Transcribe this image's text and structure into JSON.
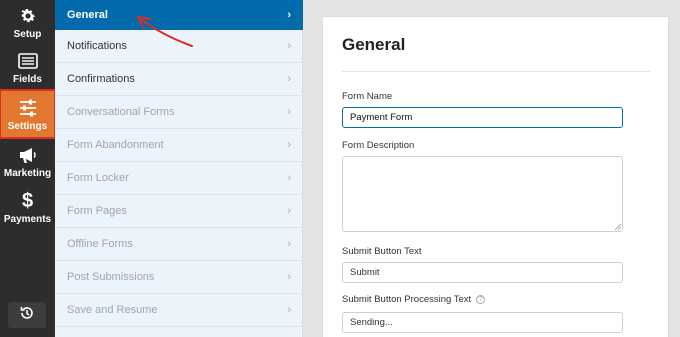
{
  "sidebar": {
    "items": [
      {
        "label": "Setup",
        "icon": "gear-icon"
      },
      {
        "label": "Fields",
        "icon": "list-icon"
      },
      {
        "label": "Settings",
        "icon": "sliders-icon"
      },
      {
        "label": "Marketing",
        "icon": "megaphone-icon"
      },
      {
        "label": "Payments",
        "icon": "dollar-icon"
      }
    ],
    "bottom_icon": "history-icon",
    "active_color": "#e27730"
  },
  "menu": {
    "items": [
      {
        "label": "General"
      },
      {
        "label": "Notifications"
      },
      {
        "label": "Confirmations"
      },
      {
        "label": "Conversational Forms"
      },
      {
        "label": "Form Abandonment"
      },
      {
        "label": "Form Locker"
      },
      {
        "label": "Form Pages"
      },
      {
        "label": "Offline Forms"
      },
      {
        "label": "Post Submissions"
      },
      {
        "label": "Save and Resume"
      }
    ],
    "active_color": "#036aab"
  },
  "panel": {
    "title": "General",
    "form_name_label": "Form Name",
    "form_name_value": "Payment Form",
    "form_description_label": "Form Description",
    "form_description_value": "",
    "submit_text_label": "Submit Button Text",
    "submit_text_value": "Submit",
    "processing_text_label": "Submit Button Processing Text",
    "processing_text_value": "Sending...",
    "help_icon": "?"
  }
}
